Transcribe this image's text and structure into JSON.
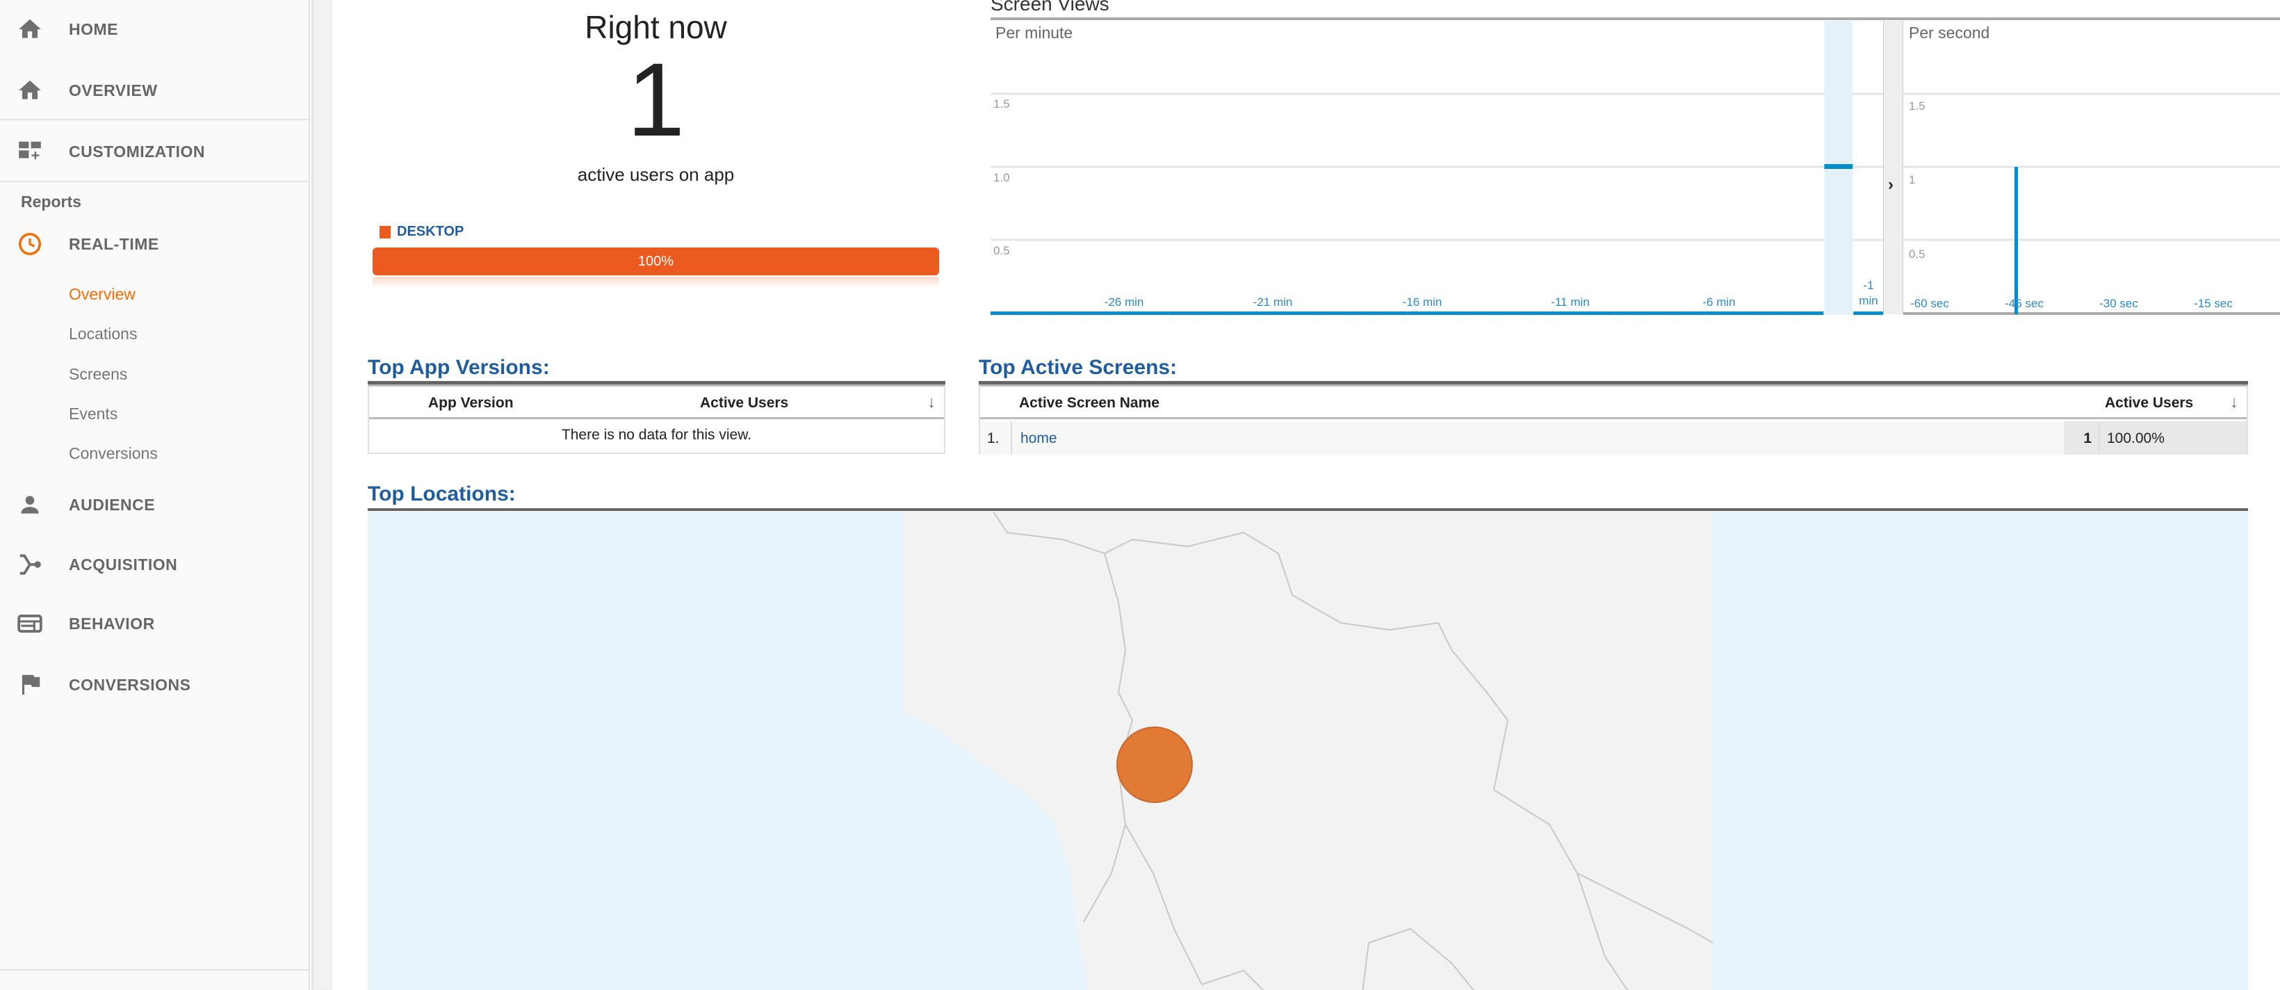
{
  "sidebar": {
    "top_items": [
      {
        "label": "HOME",
        "icon": "home-icon"
      },
      {
        "label": "OVERVIEW",
        "icon": "home-icon"
      },
      {
        "label": "CUSTOMIZATION",
        "icon": "dashboard-add-icon"
      }
    ],
    "reports_heading": "Reports",
    "realtime": {
      "label": "REAL-TIME",
      "icon": "clock-icon",
      "sub_items": [
        "Overview",
        "Locations",
        "Screens",
        "Events",
        "Conversions"
      ],
      "active": "Overview"
    },
    "report_items": [
      {
        "label": "AUDIENCE",
        "icon": "person-icon"
      },
      {
        "label": "ACQUISITION",
        "icon": "fork-icon"
      },
      {
        "label": "BEHAVIOR",
        "icon": "window-icon"
      },
      {
        "label": "CONVERSIONS",
        "icon": "flag-icon"
      }
    ]
  },
  "right_now": {
    "title": "Right now",
    "count": "1",
    "subtitle": "active users on app",
    "device_label": "DESKTOP",
    "device_percent": "100%",
    "device_share": 100,
    "device_color": "#eb5a1e"
  },
  "screen_views": {
    "title": "Screen Views",
    "per_minute": {
      "label": "Per minute",
      "y_ticks": [
        "1.5",
        "1.0",
        "0.5"
      ],
      "x_ticks": [
        "-26 min",
        "-21 min",
        "-16 min",
        "-11 min",
        "-6 min",
        "-1 min"
      ]
    },
    "per_second": {
      "label": "Per second",
      "y_ticks": [
        "1.5",
        "1",
        "0.5"
      ],
      "x_ticks": [
        "-60 sec",
        "-45 sec",
        "-30 sec",
        "-15 sec"
      ]
    }
  },
  "chart_data": [
    {
      "type": "bar",
      "title": "Per minute",
      "x_unit": "min",
      "x": [
        -30,
        -29,
        -28,
        -27,
        -26,
        -25,
        -24,
        -23,
        -22,
        -21,
        -20,
        -19,
        -18,
        -17,
        -16,
        -15,
        -14,
        -13,
        -12,
        -11,
        -10,
        -9,
        -8,
        -7,
        -6,
        -5,
        -4,
        -3,
        -2,
        -1
      ],
      "values": [
        0,
        0,
        0,
        0,
        0,
        0,
        0,
        0,
        0,
        0,
        0,
        0,
        0,
        0,
        0,
        0,
        0,
        0,
        0,
        0,
        0,
        0,
        0,
        0,
        0,
        0,
        0,
        0,
        1,
        0
      ],
      "ylim": [
        0,
        2
      ],
      "color": "#058dc7"
    },
    {
      "type": "bar",
      "title": "Per second",
      "x_unit": "sec",
      "points": [
        {
          "x": -46,
          "y": 1
        }
      ],
      "xlim": [
        -64,
        0
      ],
      "ylim": [
        0,
        2
      ],
      "color": "#058dc7"
    }
  ],
  "app_versions": {
    "title": "Top App Versions:",
    "columns": [
      "App Version",
      "Active Users"
    ],
    "empty_message": "There is no data for this view."
  },
  "active_screens": {
    "title": "Top Active Screens:",
    "columns": [
      "Active Screen Name",
      "Active Users"
    ],
    "rows": [
      {
        "index": "1.",
        "name": "home",
        "users": "1",
        "percent": "100.00%"
      }
    ]
  },
  "locations": {
    "title": "Top Locations:",
    "marker_color": "#e07a35"
  }
}
